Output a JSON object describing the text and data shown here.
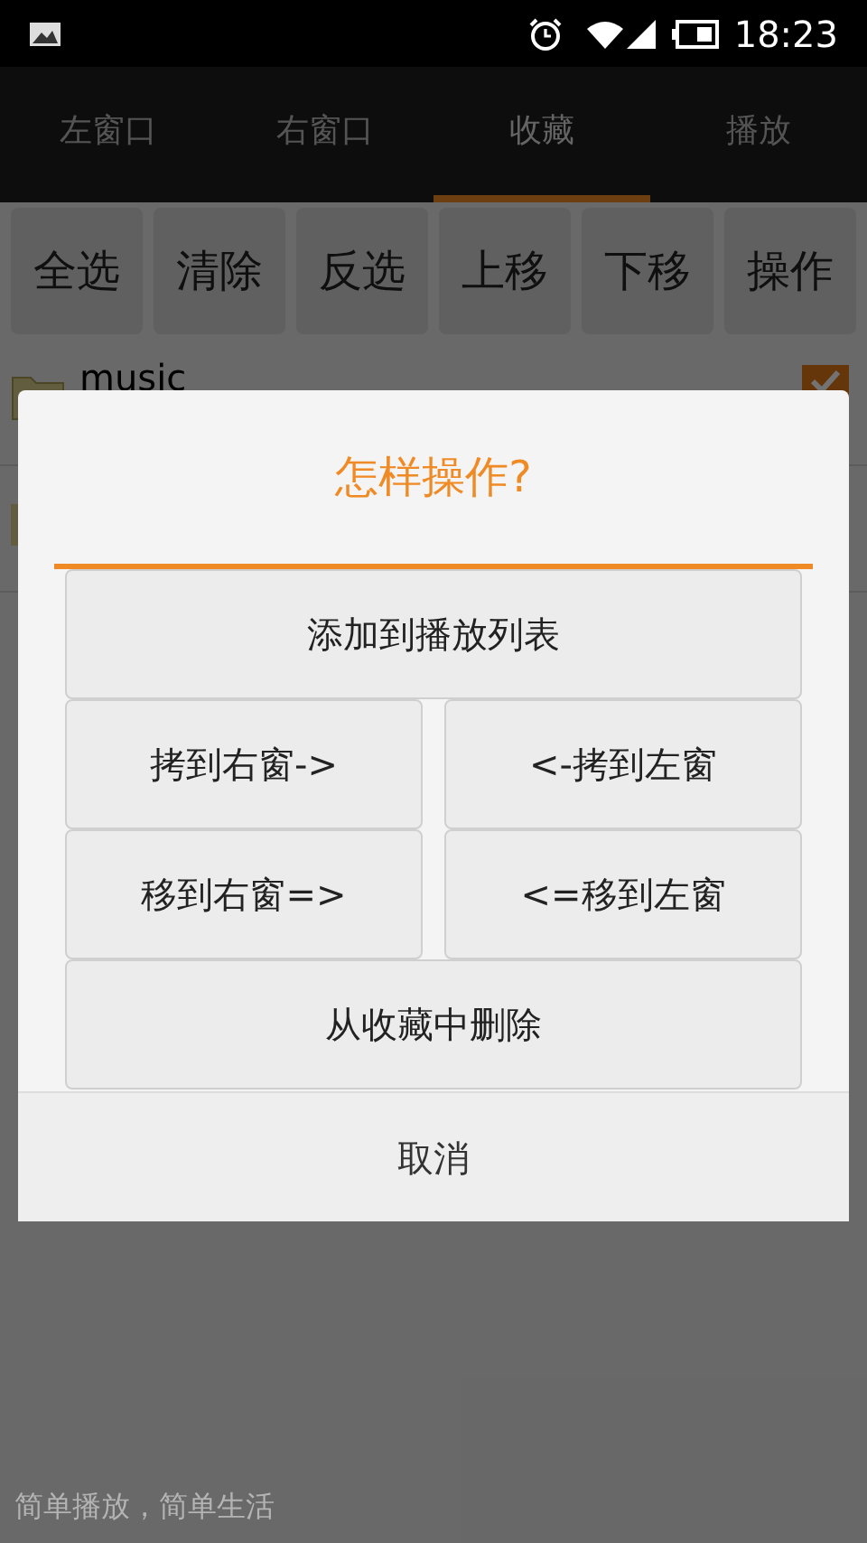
{
  "status_bar": {
    "time": "18:23"
  },
  "tabs": [
    {
      "label": "左窗口",
      "selected": false
    },
    {
      "label": "右窗口",
      "selected": false
    },
    {
      "label": "收藏",
      "selected": true
    },
    {
      "label": "播放",
      "selected": false
    }
  ],
  "toolbar": [
    "全选",
    "清除",
    "反选",
    "上移",
    "下移",
    "操作"
  ],
  "files": [
    {
      "kind": "folder",
      "name": "music",
      "checked": true
    },
    {
      "kind": "folder"
    }
  ],
  "dialog": {
    "title": "怎样操作?",
    "actions": [
      {
        "kind": "wide",
        "label": "添加到播放列表"
      },
      {
        "kind": "half",
        "label": "拷到右窗->"
      },
      {
        "kind": "half",
        "label": "<-拷到左窗"
      },
      {
        "kind": "half",
        "label": "移到右窗=>"
      },
      {
        "kind": "half",
        "label": "<=移到左窗"
      },
      {
        "kind": "wide",
        "label": "从收藏中删除"
      }
    ],
    "cancel": "取消"
  },
  "footer": "简单播放，简单生活"
}
